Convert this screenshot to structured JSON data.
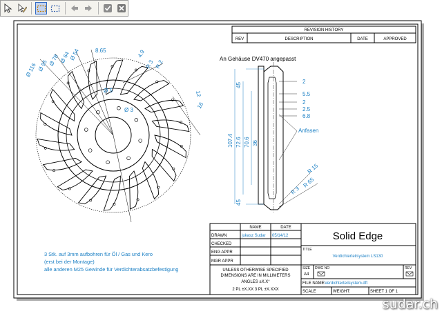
{
  "toolbar": {
    "buttons": [
      {
        "name": "select-tool",
        "icon": "pointer-icon"
      },
      {
        "name": "select-edit-tool",
        "icon": "pencil-pointer-icon"
      },
      {
        "name": "rect-select-tool",
        "icon": "dashed-rect-icon"
      },
      {
        "name": "rect-select-alt-tool",
        "icon": "dashed-rect-blue-icon"
      },
      {
        "name": "back-button",
        "icon": "arrow-left-icon"
      },
      {
        "name": "forward-button",
        "icon": "arrow-right-icon"
      },
      {
        "name": "accept-button",
        "icon": "check-icon"
      },
      {
        "name": "close-button",
        "icon": "close-icon"
      }
    ]
  },
  "revision": {
    "title": "REVISION HISTORY",
    "cols": [
      "REV",
      "DESCRIPTION",
      "DATE",
      "APPROVED"
    ]
  },
  "note_top": "An Gehäuse DV470 angepasst",
  "note_bottom": [
    "3 Stk. auf 3mm aufbohren für Öl / Gas und Kero",
    "(erst bei der Montage)",
    "alle anderen M25 Gewinde für Verdichterabsatzbefestigung"
  ],
  "dims_left": [
    "Ø 116",
    "Ø 95",
    "Ø 78",
    "Ø 64",
    "Ø 54",
    "8.65",
    "4.9",
    "R 3",
    "R 2",
    "Ø 5",
    "Ø 3",
    "12",
    "16"
  ],
  "dims_right": [
    "2",
    "5.5",
    "2",
    "2.5",
    "6.8",
    "R 15",
    "R 3",
    "R 65",
    "45",
    "107.4",
    "72.6",
    "70.6",
    "36",
    "45"
  ],
  "label_anfasen": "Anfasen",
  "title_block": {
    "name_h": "NAME",
    "date_h": "DATE",
    "rows": [
      {
        "label": "DRAWN",
        "name": "jukasz Sudar",
        "date": "05/14/12"
      },
      {
        "label": "CHECKED",
        "name": "",
        "date": ""
      },
      {
        "label": "ENG APPR",
        "name": "",
        "date": ""
      },
      {
        "label": "MGR APPR",
        "name": "",
        "date": ""
      }
    ],
    "unless": [
      "UNLESS OTHERWISE SPECIFIED",
      "DIMENSIONS ARE IN MILLIMETERS",
      "ANGLES ±X.X°",
      "2 PL ±X.XX  3 PL ±X.XXX"
    ],
    "brand": "Solid Edge",
    "title_label": "TITLE",
    "title_value": "Verdichterteilsystem LS130",
    "size_label": "SIZE",
    "size_value": "A4",
    "dwg_label": "DWG NO",
    "rev_label": "REV",
    "file_label": "FILE NAME:",
    "file_value": "Verdichterteilsystem.dft",
    "scale_label": "SCALE",
    "weight_label": "WEIGHT:",
    "sheet_label": "SHEET 1 OF 1"
  },
  "watermark": "sudar.ch",
  "colors": {
    "dimension": "#1a7fc4",
    "line": "#000000",
    "note": "#1a7fc4"
  }
}
